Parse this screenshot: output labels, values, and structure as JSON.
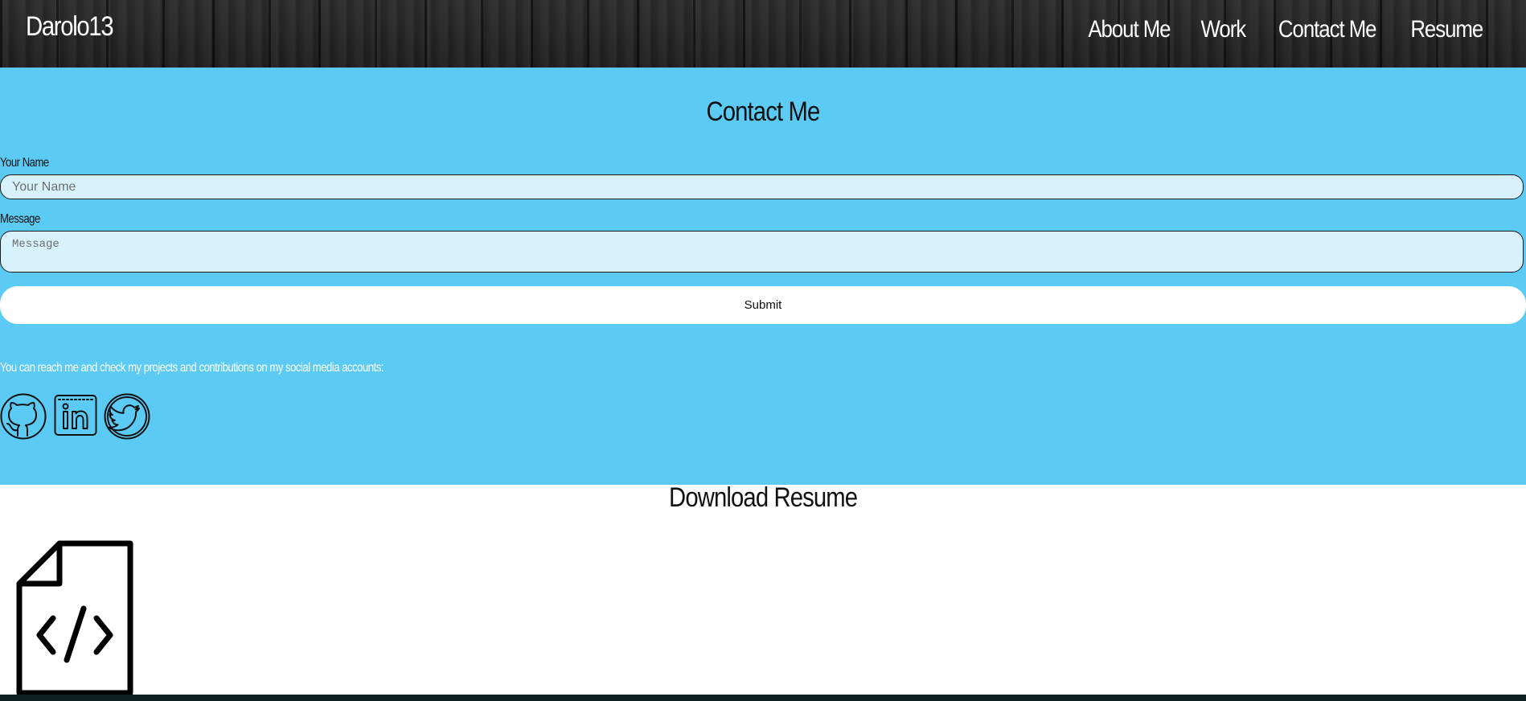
{
  "header": {
    "logo": "Darolo13",
    "nav": [
      "About Me",
      "Work",
      "Contact Me",
      "Resume"
    ]
  },
  "contact": {
    "title": "Contact Me",
    "name_label": "Your Name",
    "name_placeholder": "Your Name",
    "message_label": "Message",
    "message_placeholder": "Message",
    "submit_label": "Submit",
    "social_text": "You can reach me and check my projects and contributions on my social media accounts:",
    "social_icons": [
      "github-icon",
      "linkedin-icon",
      "twitter-icon"
    ]
  },
  "resume": {
    "title": "Download Resume",
    "icon": "code-file-icon"
  },
  "colors": {
    "contact_bg": "#5bcbf5",
    "input_bg": "#d7f2fd",
    "header_bg": "#232323",
    "bottom_bar": "#0e1f22"
  }
}
